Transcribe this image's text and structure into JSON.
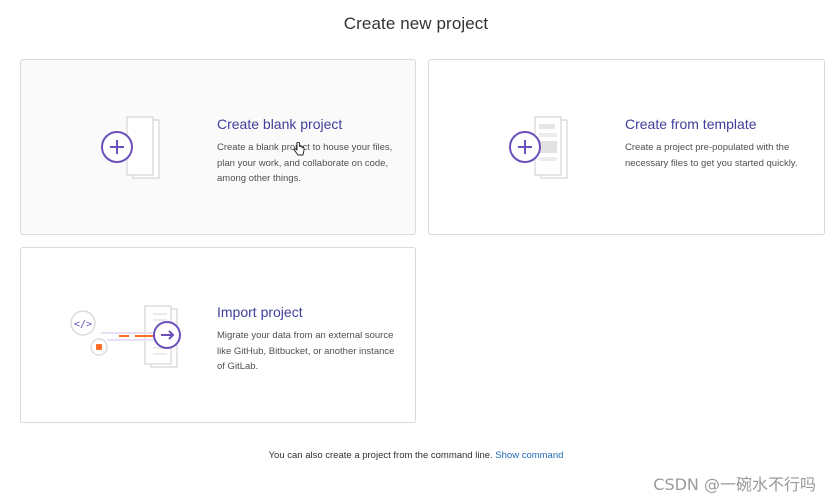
{
  "page": {
    "title": "Create new project"
  },
  "cards": [
    {
      "title": "Create blank project",
      "description": "Create a blank project to house your files, plan your work, and collaborate on code, among other things.",
      "icon": "plus-document-icon"
    },
    {
      "title": "Create from template",
      "description": "Create a project pre-populated with the necessary files to get you started quickly.",
      "icon": "template-document-icon"
    },
    {
      "title": "Import project",
      "description": "Migrate your data from an external source like GitHub, Bitbucket, or another instance of GitLab.",
      "icon": "import-document-icon"
    }
  ],
  "footer": {
    "text": "You can also create a project from the command line.",
    "link": "Show command"
  },
  "watermark": "CSDN @一碗水不行吗",
  "colors": {
    "accent": "#6b4fbb",
    "link": "#1f6ab5",
    "border": "#dbdbdb"
  }
}
